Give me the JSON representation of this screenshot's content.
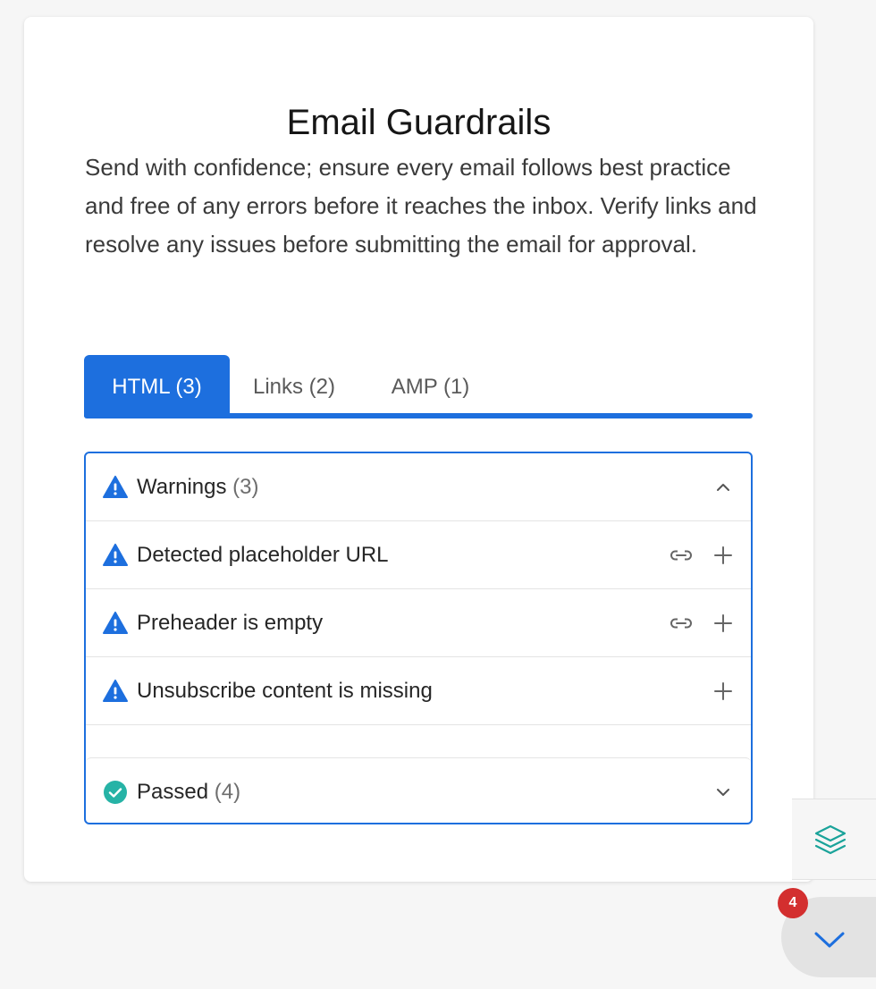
{
  "header": {
    "title": "Email Guardrails",
    "description": "Send with confidence; ensure every email follows best practice and free of any errors before it reaches the inbox. Verify links and resolve any issues before submitting the email for approval."
  },
  "tabs": [
    {
      "label": "HTML (3)",
      "active": true
    },
    {
      "label": "Links (2)",
      "active": false
    },
    {
      "label": "AMP (1)",
      "active": false
    }
  ],
  "warnings": {
    "label": "Warnings",
    "count": "(3)",
    "expanded": true,
    "items": [
      {
        "label": "Detected placeholder URL",
        "has_link_action": true
      },
      {
        "label": "Preheader is empty",
        "has_link_action": true
      },
      {
        "label": "Unsubscribe content is missing",
        "has_link_action": false
      }
    ]
  },
  "passed": {
    "label": "Passed",
    "count": "(4)",
    "expanded": false
  },
  "side": {
    "tool_icon": "layers-icon",
    "badge_count": "4",
    "scroll_icon": "chevron-down-icon"
  },
  "colors": {
    "accent": "#1d6fde",
    "success": "#26b3a6",
    "badge": "#d32f2f",
    "layers_icon": "#1aa39a"
  }
}
